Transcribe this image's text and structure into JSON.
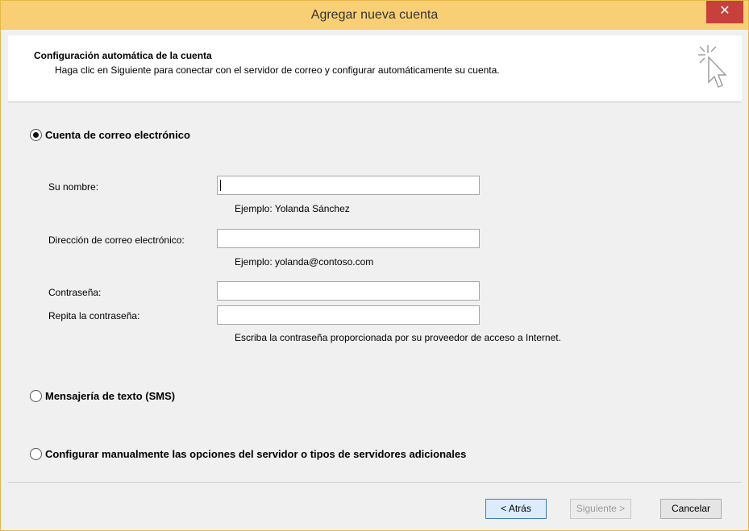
{
  "window": {
    "title": "Agregar nueva cuenta",
    "close_glyph": "✕"
  },
  "header": {
    "title": "Configuración automática de la cuenta",
    "subtitle": "Haga clic en Siguiente para conectar con el servidor de correo y configurar automáticamente su cuenta.",
    "icon": "wizard-cursor-icon"
  },
  "options": {
    "email": {
      "label": "Cuenta de correo electrónico",
      "selected": true
    },
    "sms": {
      "label": "Mensajería de texto (SMS)",
      "selected": false
    },
    "manual": {
      "label": "Configurar manualmente las opciones del servidor o tipos de servidores adicionales",
      "selected": false
    }
  },
  "form": {
    "name_label": "Su nombre:",
    "name_value": "",
    "name_hint": "Ejemplo: Yolanda Sánchez",
    "email_label": "Dirección de correo electrónico:",
    "email_value": "",
    "email_hint": "Ejemplo: yolanda@contoso.com",
    "password_label": "Contraseña:",
    "password_value": "",
    "repeat_label": "Repita la contraseña:",
    "repeat_value": "",
    "password_hint": "Escriba la contraseña proporcionada por su proveedor de acceso a Internet."
  },
  "buttons": {
    "back": "< Atrás",
    "next": "Siguiente >",
    "cancel": "Cancelar"
  },
  "colors": {
    "titlebar": "#f8cf74",
    "close": "#c8403c",
    "focus_border": "#3c7fb1"
  }
}
